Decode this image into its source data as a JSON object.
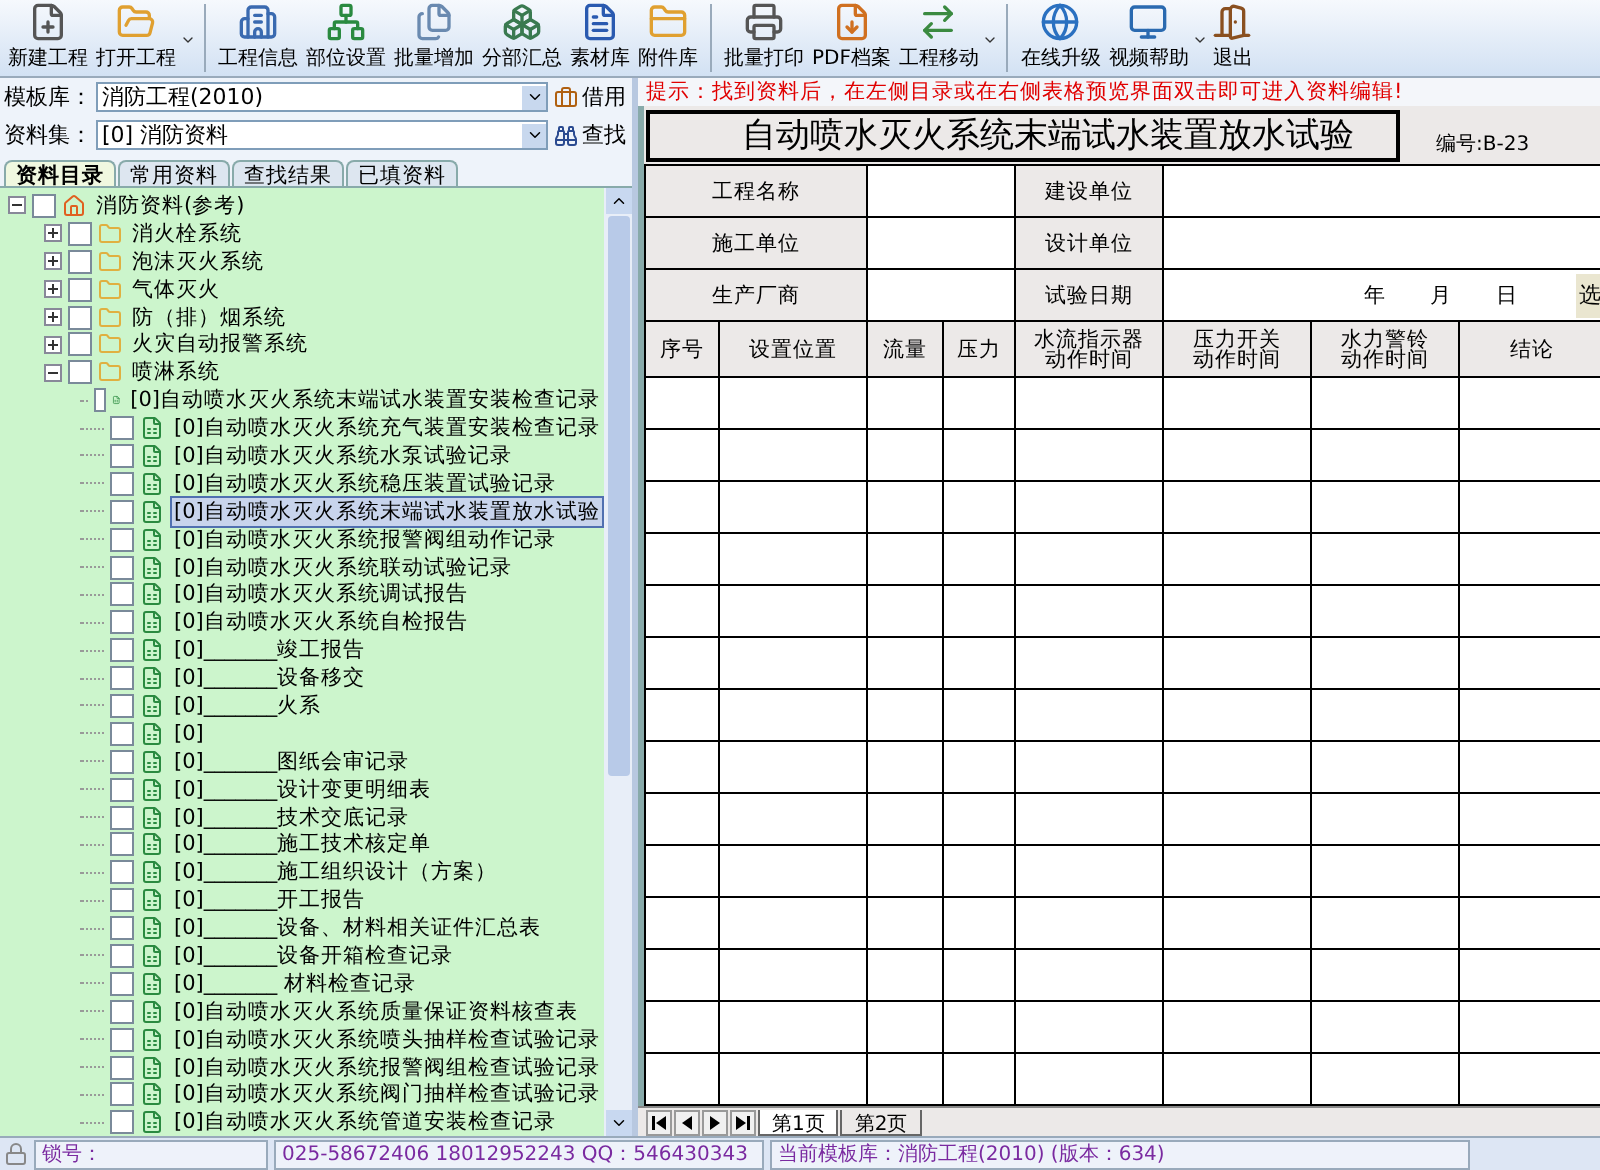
{
  "toolbar": [
    {
      "label": "新建工程",
      "has_menu": false,
      "group_end": false
    },
    {
      "label": "打开工程",
      "has_menu": true,
      "group_end": true
    },
    {
      "label": "工程信息",
      "has_menu": false,
      "group_end": false
    },
    {
      "label": "部位设置",
      "has_menu": false,
      "group_end": false
    },
    {
      "label": "批量增加",
      "has_menu": false,
      "group_end": false
    },
    {
      "label": "分部汇总",
      "has_menu": false,
      "group_end": false
    },
    {
      "label": "素材库",
      "has_menu": false,
      "group_end": false
    },
    {
      "label": "附件库",
      "has_menu": false,
      "group_end": true
    },
    {
      "label": "批量打印",
      "has_menu": false,
      "group_end": false
    },
    {
      "label": "PDF档案",
      "has_menu": false,
      "group_end": false
    },
    {
      "label": "工程移动",
      "has_menu": true,
      "group_end": true
    },
    {
      "label": "在线升级",
      "has_menu": false,
      "group_end": false
    },
    {
      "label": "视频帮助",
      "has_menu": true,
      "group_end": false
    },
    {
      "label": "退出",
      "has_menu": false,
      "group_end": false
    }
  ],
  "template": {
    "label": "模板库：",
    "value": "消防工程(2010)",
    "button": "借用"
  },
  "dataset": {
    "label": "资料集：",
    "value": "[0] 消防资料",
    "button": "查找"
  },
  "tabs": [
    {
      "label": "资料目录",
      "selected": true
    },
    {
      "label": "常用资料",
      "selected": false
    },
    {
      "label": "查找结果",
      "selected": false
    },
    {
      "label": "已填资料",
      "selected": false
    }
  ],
  "tree": [
    {
      "label": "消防资料(参考)",
      "kind": "root",
      "expanded": true,
      "checked": false,
      "selected": false,
      "children": [
        {
          "label": "消火栓系统",
          "kind": "folder",
          "expanded": false,
          "checked": false,
          "selected": false
        },
        {
          "label": "泡沫灭火系统",
          "kind": "folder",
          "expanded": false,
          "checked": false,
          "selected": false
        },
        {
          "label": "气体灭火",
          "kind": "folder",
          "expanded": false,
          "checked": false,
          "selected": false
        },
        {
          "label": "防（排）烟系统",
          "kind": "folder",
          "expanded": false,
          "checked": false,
          "selected": false
        },
        {
          "label": "火灾自动报警系统",
          "kind": "folder",
          "expanded": false,
          "checked": false,
          "selected": false
        },
        {
          "label": "喷淋系统",
          "kind": "folder",
          "expanded": true,
          "checked": false,
          "selected": false,
          "children": [
            {
              "label": "[0]自动喷水灭火系统末端试水装置安装检查记录",
              "kind": "file",
              "checked": false,
              "selected": false
            },
            {
              "label": "[0]自动喷水灭火系统充气装置安装检查记录",
              "kind": "file",
              "checked": false,
              "selected": false
            },
            {
              "label": "[0]自动喷水灭火系统水泵试验记录",
              "kind": "file",
              "checked": false,
              "selected": false
            },
            {
              "label": "[0]自动喷水灭火系统稳压装置试验记录",
              "kind": "file",
              "checked": false,
              "selected": false
            },
            {
              "label": "[0]自动喷水灭火系统末端试水装置放水试验",
              "kind": "file",
              "checked": false,
              "selected": true
            },
            {
              "label": "[0]自动喷水灭火系统报警阀组动作记录",
              "kind": "file",
              "checked": false,
              "selected": false
            },
            {
              "label": "[0]自动喷水灭火系统联动试验记录",
              "kind": "file",
              "checked": false,
              "selected": false
            },
            {
              "label": "[0]自动喷水灭火系统调试报告",
              "kind": "file",
              "checked": false,
              "selected": false
            },
            {
              "label": "[0]自动喷水灭火系统自检报告",
              "kind": "file",
              "checked": false,
              "selected": false
            },
            {
              "label": "[0]_______竣工报告",
              "kind": "file",
              "checked": false,
              "selected": false
            },
            {
              "label": "[0]_______设备移交",
              "kind": "file",
              "checked": false,
              "selected": false
            },
            {
              "label": "[0]_______火系",
              "kind": "file",
              "checked": false,
              "selected": false
            },
            {
              "label": "[0]",
              "kind": "file",
              "checked": false,
              "selected": false
            },
            {
              "label": "[0]_______图纸会审记录",
              "kind": "file",
              "checked": false,
              "selected": false
            },
            {
              "label": "[0]_______设计变更明细表",
              "kind": "file",
              "checked": false,
              "selected": false
            },
            {
              "label": "[0]_______技术交底记录",
              "kind": "file",
              "checked": false,
              "selected": false
            },
            {
              "label": "[0]_______施工技术核定单",
              "kind": "file",
              "checked": false,
              "selected": false
            },
            {
              "label": "[0]_______施工组织设计（方案）",
              "kind": "file",
              "checked": false,
              "selected": false
            },
            {
              "label": "[0]_______开工报告",
              "kind": "file",
              "checked": false,
              "selected": false
            },
            {
              "label": "[0]_______设备、材料相关证件汇总表",
              "kind": "file",
              "checked": false,
              "selected": false
            },
            {
              "label": "[0]_______设备开箱检查记录",
              "kind": "file",
              "checked": false,
              "selected": false
            },
            {
              "label": "[0]_______ 材料检查记录",
              "kind": "file",
              "checked": false,
              "selected": false
            },
            {
              "label": "[0]自动喷水灭火系统质量保证资料核查表",
              "kind": "file",
              "checked": false,
              "selected": false
            },
            {
              "label": "[0]自动喷水灭火系统喷头抽样检查试验记录",
              "kind": "file",
              "checked": false,
              "selected": false
            },
            {
              "label": "[0]自动喷水灭火系统报警阀组检查试验记录",
              "kind": "file",
              "checked": false,
              "selected": false
            },
            {
              "label": "[0]自动喷水灭火系统阀门抽样检查试验记录",
              "kind": "file",
              "checked": false,
              "selected": false
            },
            {
              "label": "[0]自动喷水灭火系统管道安装检查记录",
              "kind": "file",
              "checked": false,
              "selected": false
            }
          ]
        }
      ]
    }
  ],
  "hint": "提示：找到资料后，在左侧目录或在右侧表格预览界面双击即可进入资料编辑!",
  "form": {
    "title": "自动喷水灭火系统末端试水装置放水试验",
    "code": "编号:B-23",
    "info_rows": [
      [
        "工程名称",
        "",
        "建设单位",
        ""
      ],
      [
        "施工单位",
        "",
        "设计单位",
        ""
      ],
      [
        "生产厂商",
        "",
        "试验日期",
        "年　　月　　日"
      ]
    ],
    "date_button": "选",
    "columns": [
      "序号",
      "设置位置",
      "流量",
      "压力",
      "水流指示器动作时间",
      "压力开关动作时间",
      "水力警铃动作时间",
      "结论"
    ]
  },
  "sheet_tabs": [
    {
      "label": "第1页",
      "selected": true
    },
    {
      "label": "第2页",
      "selected": false
    }
  ],
  "status_bar": {
    "lock_label": "锁号：",
    "contact": "025-58672406 18012952243  QQ：546430343",
    "current": "当前模板库：消防工程(2010) (版本：634)"
  }
}
